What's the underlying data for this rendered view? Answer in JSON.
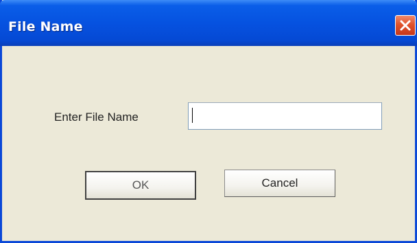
{
  "window": {
    "title": "File Name",
    "close_icon": "close-icon"
  },
  "form": {
    "label": "Enter File Name",
    "input_value": "",
    "input_placeholder": ""
  },
  "buttons": {
    "ok_label": "OK",
    "cancel_label": "Cancel"
  },
  "colors": {
    "titlebar": "#0652e0",
    "dialog_bg": "#ece9d8",
    "close_button": "#e0532c"
  }
}
